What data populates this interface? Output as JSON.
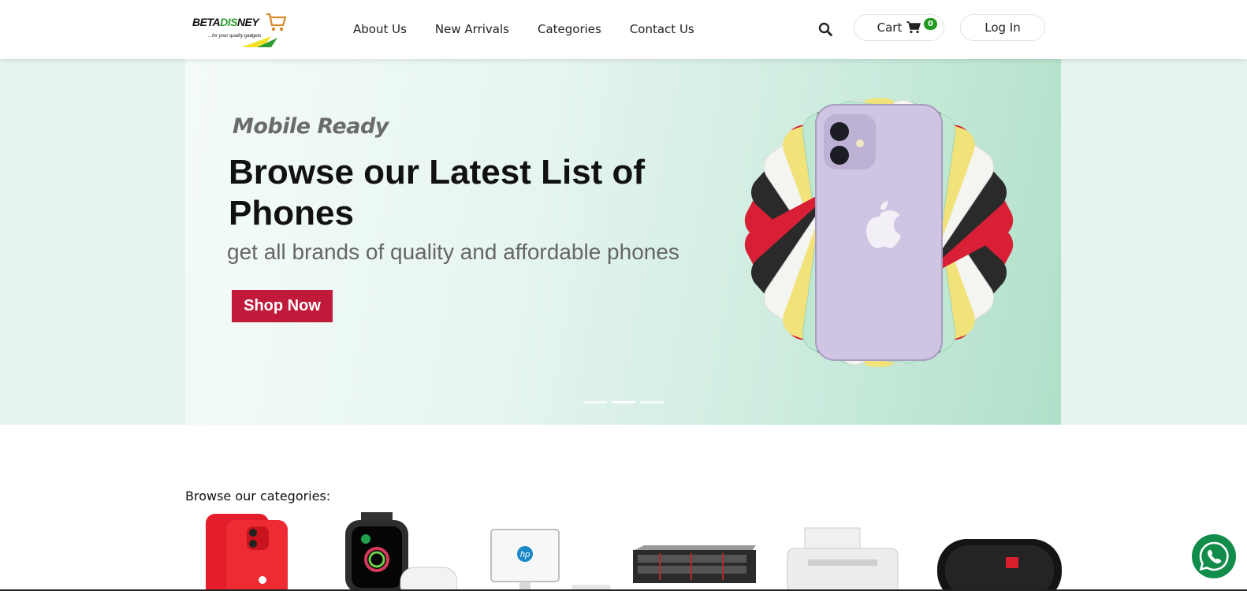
{
  "header": {
    "logo": {
      "brand_text": "BETADISNEY",
      "tagline": "...for your quality gadgets"
    },
    "nav": [
      {
        "label": "About Us"
      },
      {
        "label": "New Arrivals"
      },
      {
        "label": "Categories"
      },
      {
        "label": "Contact Us"
      }
    ],
    "search_icon": "search-icon",
    "cart": {
      "label": "Cart",
      "icon": "cart-icon",
      "count": "0"
    },
    "login_label": "Log In"
  },
  "hero": {
    "kicker": "Mobile Ready",
    "title": "Browse our Latest List of Phones",
    "subtitle": "get all brands of quality and affordable phones",
    "button_label": "Shop Now",
    "slides": 3,
    "active_slide": 2
  },
  "categories": {
    "heading": "Browse our categories:",
    "items": [
      {
        "icon": "smartphone-image"
      },
      {
        "icon": "smartwatch-image"
      },
      {
        "icon": "desktop-computer-image"
      },
      {
        "icon": "server-image"
      },
      {
        "icon": "printer-image"
      },
      {
        "icon": "speaker-image"
      }
    ]
  },
  "colors": {
    "accent_red": "#c0193a",
    "badge_green": "#1f9a1f",
    "whatsapp_green": "#128c4a"
  },
  "whatsapp_icon": "whatsapp-icon"
}
